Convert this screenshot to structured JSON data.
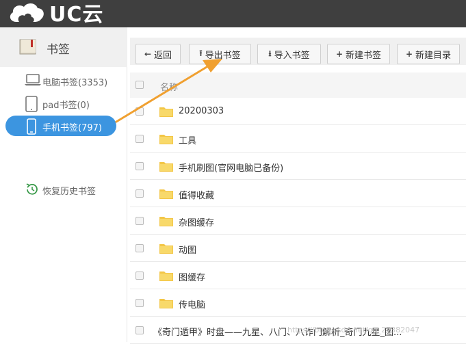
{
  "app": {
    "logo_text": "UC云"
  },
  "sidebar": {
    "title": "书签",
    "items": [
      {
        "label": "电脑书签(3353)",
        "icon": "laptop-icon"
      },
      {
        "label": "pad书签(0)",
        "icon": "tablet-icon"
      },
      {
        "label": "手机书签(797)",
        "icon": "phone-icon",
        "active": true
      }
    ],
    "restore_label": "恢复历史书签"
  },
  "toolbar": {
    "back_label": "返回",
    "export_label": "导出书签",
    "import_label": "导入书签",
    "new_bookmark_label": "新建书签",
    "new_folder_label": "新建目录"
  },
  "table": {
    "header_name": "名称",
    "rows": [
      {
        "name": "20200303",
        "type": "folder"
      },
      {
        "name": "工具",
        "type": "folder"
      },
      {
        "name": "手机刷图(官网电脑已备份)",
        "type": "folder"
      },
      {
        "name": "值得收藏",
        "type": "folder"
      },
      {
        "name": "杂图缓存",
        "type": "folder"
      },
      {
        "name": "动图",
        "type": "folder"
      },
      {
        "name": "图缓存",
        "type": "folder"
      },
      {
        "name": "传电脑",
        "type": "folder"
      },
      {
        "name": "《奇门遁甲》时盘——九星、八门、八诈门解析_奇门九星_图...",
        "type": "bookmark"
      }
    ]
  },
  "watermark": "https://blog.csdn.net/qq_27382047",
  "colors": {
    "topbar": "#3f3f3f",
    "active_item": "#3c95e0",
    "arrow": "#f0a030",
    "folder": "#f3c646"
  }
}
